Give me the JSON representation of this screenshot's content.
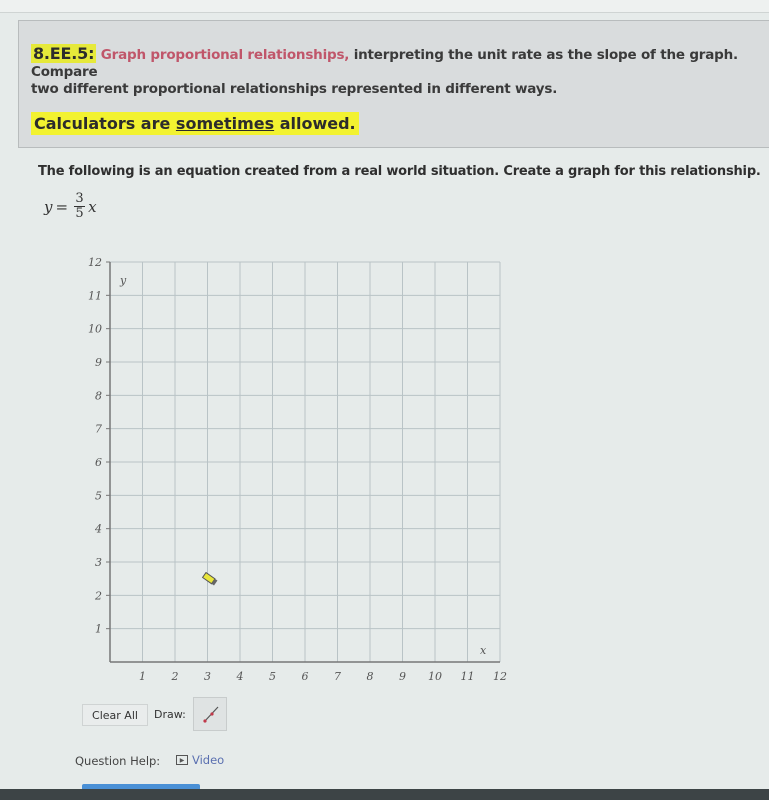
{
  "standard": {
    "code": "8.EE.5:",
    "text_part1": "Graph proportional relationships,",
    "text_part2": " interpreting the unit rate as the slope of the graph. Compare",
    "text_line2": "two different proportional relationships represented in different ways.",
    "calc_before": "Calculators are ",
    "calc_underlined": "sometimes",
    "calc_after": " allowed."
  },
  "question": {
    "prompt": "The following is an equation created from a real world situation.  Create a graph for this relationship.",
    "equation": {
      "lhs": "y",
      "equals": "=",
      "numerator": "3",
      "denominator": "5",
      "variable": "x"
    }
  },
  "chart_data": {
    "type": "scatter",
    "title": "",
    "xlabel": "x",
    "ylabel": "y",
    "xlim": [
      0,
      12
    ],
    "ylim": [
      0,
      12
    ],
    "x_ticks": [
      "1",
      "2",
      "3",
      "4",
      "5",
      "6",
      "7",
      "8",
      "9",
      "10",
      "11",
      "12"
    ],
    "y_ticks": [
      "1",
      "2",
      "3",
      "4",
      "5",
      "6",
      "7",
      "8",
      "9",
      "10",
      "11",
      "12"
    ],
    "grid": true,
    "series": []
  },
  "controls": {
    "clear_all": "Clear All",
    "draw_label": "Draw:",
    "draw_tool": "line-tool-icon"
  },
  "help": {
    "label": "Question Help:",
    "video_icon": "play-icon",
    "video": "Video"
  },
  "colors": {
    "highlight": "#f2f230",
    "link": "#5a6fb0",
    "progress": "#4a90d6",
    "grid": "#b9c3c6"
  }
}
